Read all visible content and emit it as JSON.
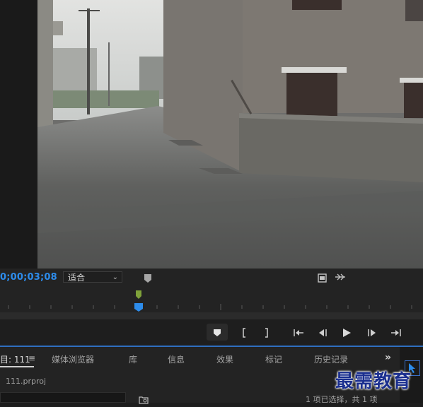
{
  "monitor": {
    "timecode": "0;00;03;08",
    "zoom_select": "适合",
    "icons": {
      "marker": "marker-icon",
      "export_frame": "camera-icon",
      "settings": "wrench-icon"
    }
  },
  "transport": {
    "buttons": [
      {
        "name": "add-marker",
        "icon": "marker-icon"
      },
      {
        "name": "mark-in",
        "icon": "mark-in-icon"
      },
      {
        "name": "mark-out",
        "icon": "mark-out-icon"
      },
      {
        "name": "go-to-in",
        "icon": "go-to-in-icon"
      },
      {
        "name": "step-back",
        "icon": "step-back-icon"
      },
      {
        "name": "play",
        "icon": "play-icon"
      },
      {
        "name": "step-forward",
        "icon": "step-forward-icon"
      },
      {
        "name": "go-to-out",
        "icon": "go-to-out-icon"
      }
    ]
  },
  "panel": {
    "tabs": [
      "目: 111",
      "媒体浏览器",
      "库",
      "信息",
      "效果",
      "标记",
      "历史记录"
    ],
    "tab_menu_glyph": "≡",
    "overflow_glyph": "»",
    "project_file": "111.prproj",
    "selection_status": "1 项已选择，共 1 项"
  },
  "watermark": "最需教育",
  "colors": {
    "accent_blue": "#2d8ceb",
    "marker_green": "#7fa23a",
    "playhead_blue": "#2d8ceb"
  }
}
